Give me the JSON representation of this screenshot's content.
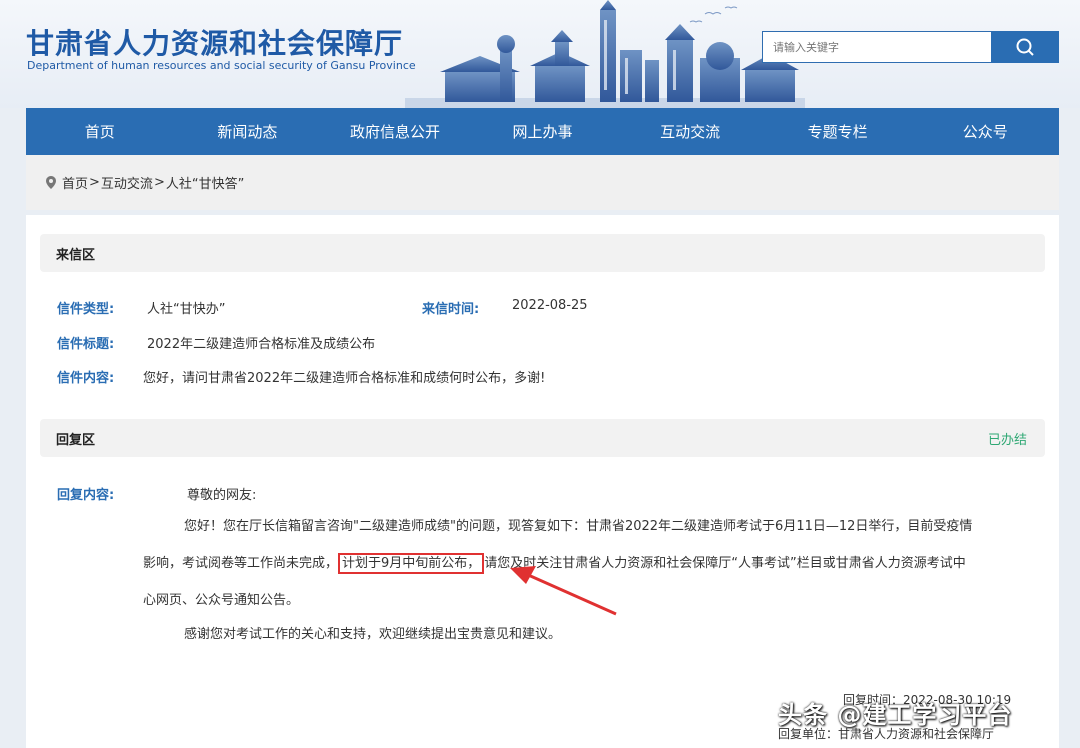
{
  "header": {
    "title": "甘肃省人力资源和社会保障厅",
    "subtitle": "Department of human resources and social security of Gansu Province",
    "search_placeholder": "请输入关键字"
  },
  "nav": {
    "items": [
      "首页",
      "新闻动态",
      "政府信息公开",
      "网上办事",
      "互动交流",
      "专题专栏",
      "公众号"
    ]
  },
  "breadcrumb": {
    "home": "首页",
    "sep": ">",
    "section": "互动交流",
    "current": "人社“甘快答”"
  },
  "letter": {
    "section_title": "来信区",
    "type_label": "信件类型:",
    "type_value": "人社“甘快办”",
    "time_label": "来信时间:",
    "time_value": "2022-08-25",
    "subject_label": "信件标题:",
    "subject_value": "2022年二级建造师合格标准及成绩公布",
    "content_label": "信件内容:",
    "content_value": "您好，请问甘肃省2022年二级建造师合格标准和成绩何时公布，多谢!"
  },
  "reply": {
    "section_title": "回复区",
    "status": "已办结",
    "content_label": "回复内容:",
    "greeting": "尊敬的网友:",
    "para1_line1": "您好！您在厅长信箱留言咨询\"二级建造师成绩\"的问题，现答复如下：甘肃省2022年二级建造师考试于6月11日—12日举行，目前受疫情",
    "para1_line2_a": "影响，考试阅卷等工作尚未完成，",
    "para1_highlight": "计划于9月中旬前公布，",
    "para1_line2_b": "请您及时关注甘肃省人力资源和社会保障厅“人事考试”栏目或甘肃省人力资源考试中",
    "para1_line3": "心网页、公众号通知公告。",
    "para2": "感谢您对考试工作的关心和支持，欢迎继续提出宝贵意见和建议。",
    "time_line": "回复时间：2022-08-30 10:19",
    "unit_line": "回复单位：甘肃省人力资源和社会保障厅"
  },
  "watermark": "头条 @建工学习平台",
  "colors": {
    "brand_blue": "#2a6db3",
    "title_blue": "#1f5aa6",
    "status_green": "#2fa874",
    "highlight_red": "#e03131"
  }
}
